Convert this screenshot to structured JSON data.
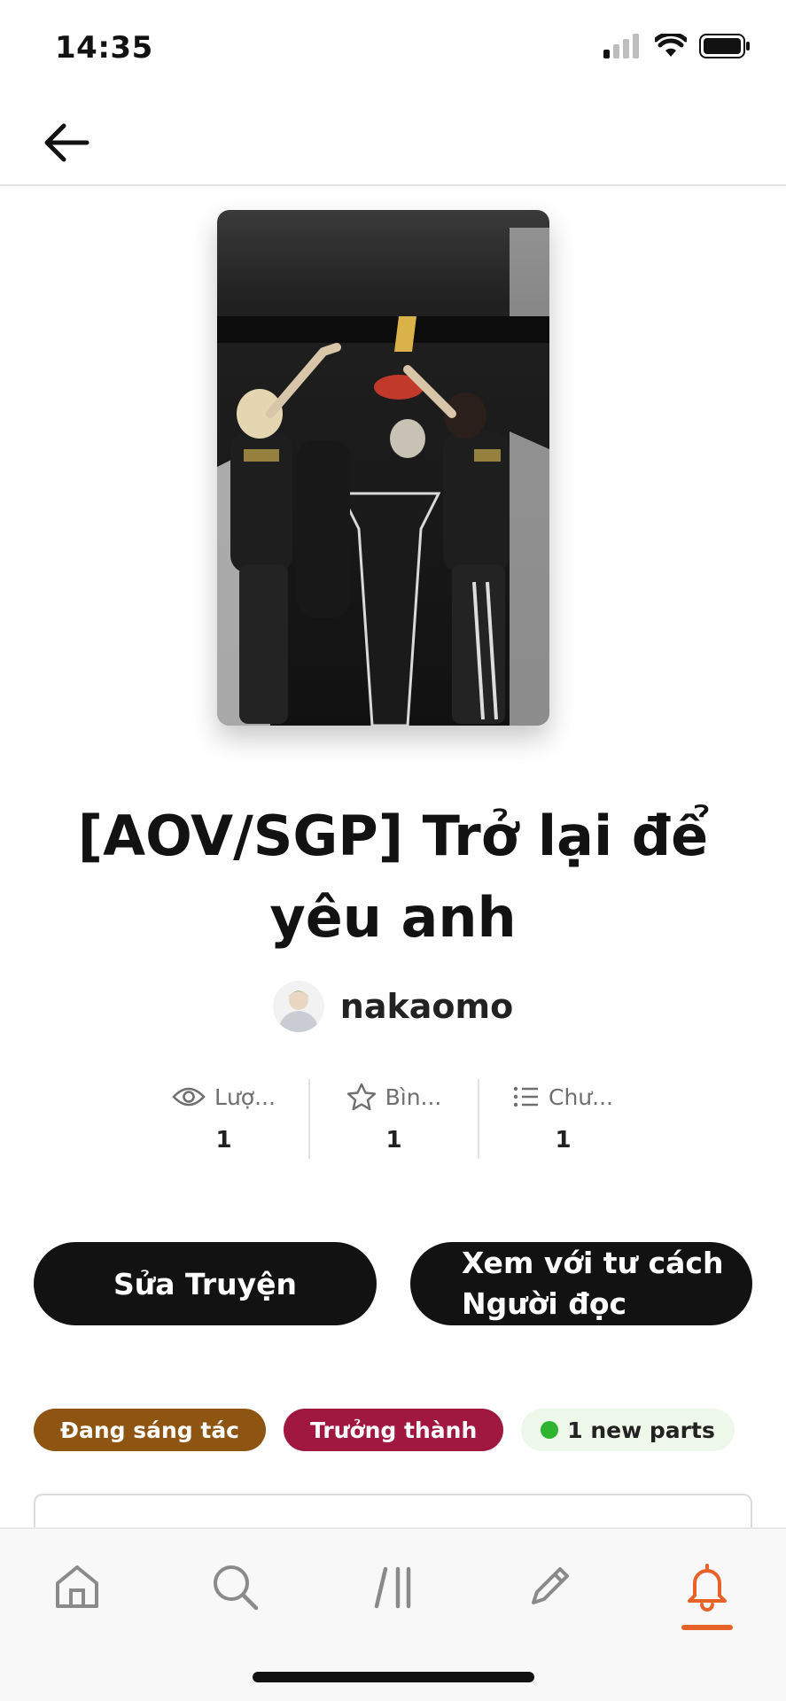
{
  "status_bar": {
    "time": "14:35"
  },
  "story": {
    "title": "[AOV/SGP] Trở lại để yêu anh",
    "author": "nakaomo"
  },
  "stats": [
    {
      "icon": "eye-icon",
      "label": "Lượ...",
      "value": "1"
    },
    {
      "icon": "star-icon",
      "label": "Bìn...",
      "value": "1"
    },
    {
      "icon": "list-icon",
      "label": "Chư...",
      "value": "1"
    }
  ],
  "actions": {
    "edit_label": "Sửa Truyện",
    "view_as_reader_label": "Xem với tư cách Người đọc"
  },
  "tags": {
    "status": "Đang sáng tác",
    "rating": "Trưởng thành",
    "new_parts": "1 new parts"
  },
  "bottom_nav": {
    "tabs": [
      "home-icon",
      "search-icon",
      "library-icon",
      "write-icon",
      "notification-bell-icon"
    ],
    "active": "notification-bell-icon"
  },
  "colors": {
    "accent": "#e8632a",
    "ongoing_tag": "#8e5512",
    "mature_tag": "#a0173f",
    "button": "#121212",
    "new_dot": "#2fb42f"
  }
}
